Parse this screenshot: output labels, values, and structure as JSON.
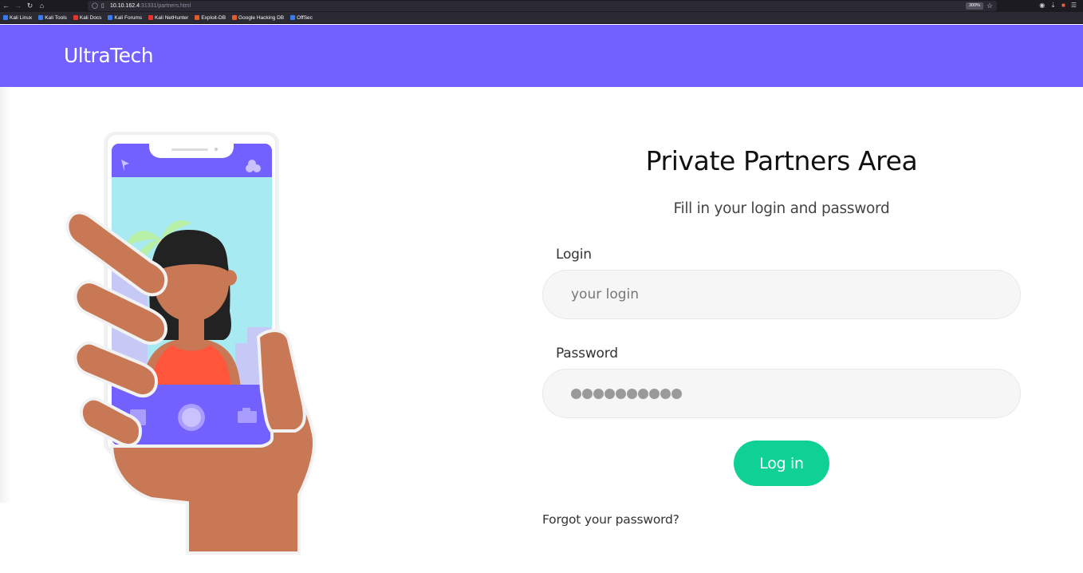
{
  "browser": {
    "url_host": "10.10.162.4",
    "url_path": ":31331/partners.html",
    "zoom": "300%",
    "bookmarks": [
      {
        "label": "Kali Linux",
        "color": "#367bf0"
      },
      {
        "label": "Kali Tools",
        "color": "#367bf0"
      },
      {
        "label": "Kali Docs",
        "color": "#e8332a"
      },
      {
        "label": "Kali Forums",
        "color": "#367bf0"
      },
      {
        "label": "Kali NetHunter",
        "color": "#e8332a"
      },
      {
        "label": "Exploit-DB",
        "color": "#e35d2b"
      },
      {
        "label": "Google Hacking DB",
        "color": "#e35d2b"
      },
      {
        "label": "OffSec",
        "color": "#367bf0"
      }
    ]
  },
  "header": {
    "brand": "UltraTech",
    "bg_color": "#7260ff"
  },
  "login": {
    "title": "Private Partners Area",
    "subtitle": "Fill in your login and password",
    "login_label": "Login",
    "login_placeholder": "your login",
    "password_label": "Password",
    "password_length": 10,
    "button_label": "Log in",
    "button_color": "#0fd196",
    "forgot_label": "Forgot your password?"
  },
  "illustration": {
    "icon": "person-holding-phone-illustration"
  }
}
